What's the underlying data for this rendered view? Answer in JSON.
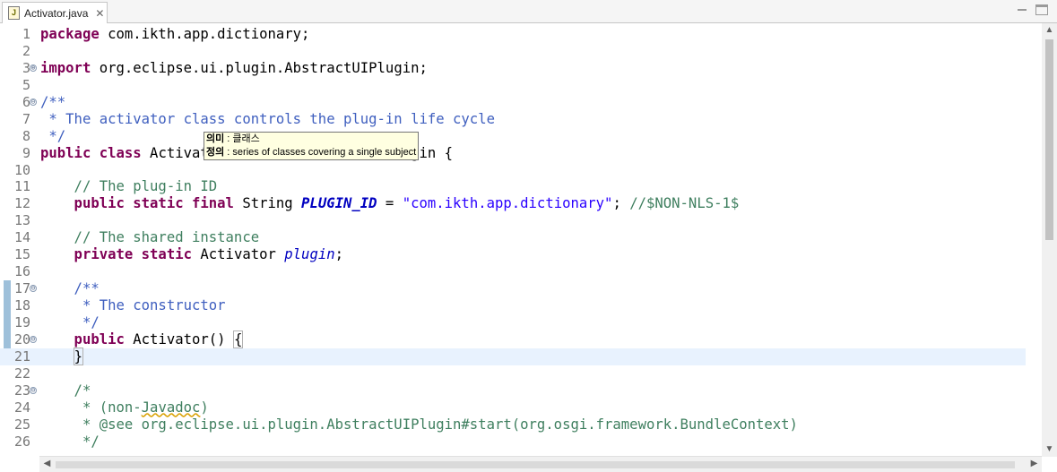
{
  "tab": {
    "filename": "Activator.java",
    "close_glyph": "✕",
    "file_icon": "java-file-icon"
  },
  "tooltip": {
    "meaning_label": "의미",
    "meaning_value": " : 클래스",
    "def_label": "정의",
    "def_value": " : series of classes covering a single subject"
  },
  "lines": [
    {
      "n": "1",
      "fold": ""
    },
    {
      "n": "2",
      "fold": ""
    },
    {
      "n": "3",
      "fold": "⊕"
    },
    {
      "n": "5",
      "fold": ""
    },
    {
      "n": "6",
      "fold": "⊖"
    },
    {
      "n": "7",
      "fold": ""
    },
    {
      "n": "8",
      "fold": ""
    },
    {
      "n": "9",
      "fold": ""
    },
    {
      "n": "10",
      "fold": ""
    },
    {
      "n": "11",
      "fold": ""
    },
    {
      "n": "12",
      "fold": ""
    },
    {
      "n": "13",
      "fold": ""
    },
    {
      "n": "14",
      "fold": ""
    },
    {
      "n": "15",
      "fold": ""
    },
    {
      "n": "16",
      "fold": ""
    },
    {
      "n": "17",
      "fold": "⊖"
    },
    {
      "n": "18",
      "fold": ""
    },
    {
      "n": "19",
      "fold": ""
    },
    {
      "n": "20",
      "fold": "⊖"
    },
    {
      "n": "21",
      "fold": ""
    },
    {
      "n": "22",
      "fold": ""
    },
    {
      "n": "23",
      "fold": "⊖"
    },
    {
      "n": "24",
      "fold": ""
    },
    {
      "n": "25",
      "fold": ""
    },
    {
      "n": "26",
      "fold": ""
    }
  ],
  "code": {
    "l1_kw": "package",
    "l1_rest": " com.ikth.app.dictionary;",
    "l3_kw": "import",
    "l3_rest": " org.eclipse.ui.plugin.AbstractUIPlugin;",
    "l6": "/**",
    "l7": " * The activator class controls the plug-in life cycle",
    "l8": " */",
    "l9_kw": "public class",
    "l9_rest": " Activator extends AbstractUIPlugin {",
    "l11": "    // The plug-in ID",
    "l12_kw": "    public static final",
    "l12_type": " String ",
    "l12_field": "PLUGIN_ID",
    "l12_eq": " = ",
    "l12_str": "\"com.ikth.app.dictionary\"",
    "l12_semi": "; ",
    "l12_cm": "//$NON-NLS-1$",
    "l14": "    // The shared instance",
    "l15_kw": "    private static",
    "l15_type": " Activator ",
    "l15_field": "plugin",
    "l15_semi": ";",
    "l17": "    /**",
    "l18": "     * The constructor",
    "l19": "     */",
    "l20_kw": "    public",
    "l20_rest": " Activator() ",
    "l20_brace": "{",
    "l21_indent": "    ",
    "l21_brace": "}",
    "l23": "    /*",
    "l24_pre": "     * (non-",
    "l24_word": "Javadoc",
    "l24_post": ")",
    "l25": "     * @see org.eclipse.ui.plugin.AbstractUIPlugin#start(org.osgi.framework.BundleContext)",
    "l26": "     */"
  }
}
